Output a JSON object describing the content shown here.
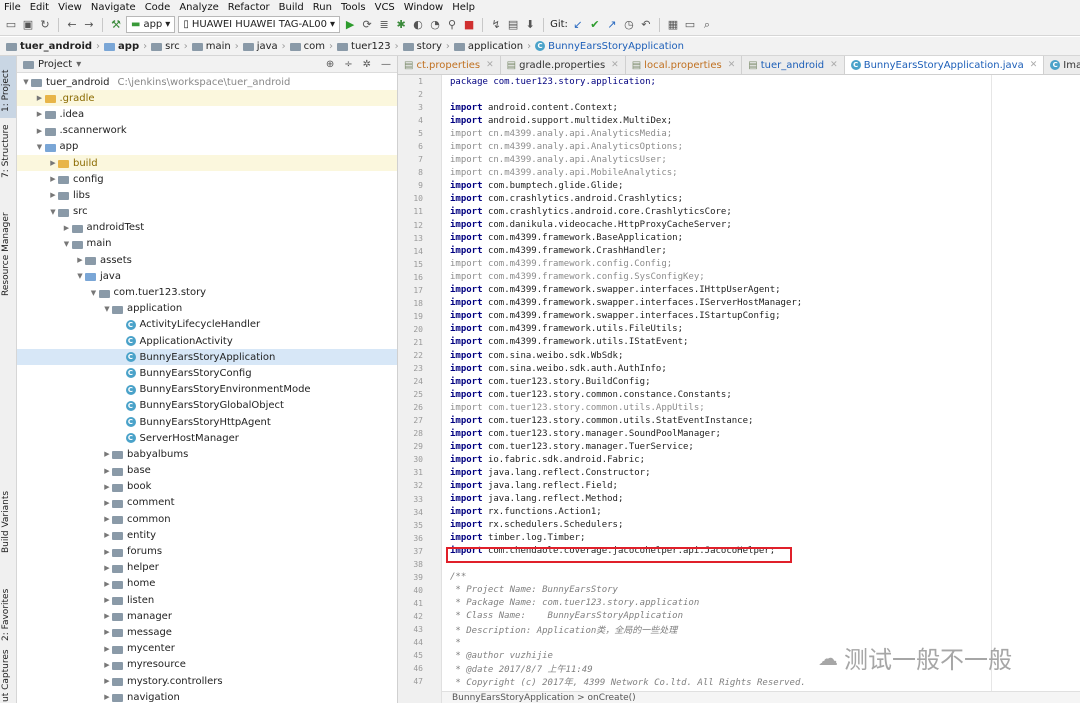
{
  "menu": [
    "File",
    "Edit",
    "View",
    "Navigate",
    "Code",
    "Analyze",
    "Refactor",
    "Build",
    "Run",
    "Tools",
    "VCS",
    "Window",
    "Help"
  ],
  "toolbar": {
    "config": "app",
    "device": "HUAWEI HUAWEI TAG-AL00",
    "git_label": "Git:"
  },
  "breadcrumb": [
    "tuer_android",
    "app",
    "src",
    "main",
    "java",
    "com",
    "tuer123",
    "story",
    "application",
    "BunnyEarsStoryApplication"
  ],
  "side_tabs": {
    "project": "1: Project",
    "structure": "7: Structure",
    "resource": "Resource Manager",
    "variants": "Build Variants",
    "favorites": "2: Favorites",
    "captures": "ut Captures"
  },
  "project_panel": {
    "title": "Project"
  },
  "tree": [
    {
      "label": "tuer_android",
      "extra": "C:\\jenkins\\workspace\\tuer_android",
      "indent": 0,
      "arrow": "▼",
      "icon": "fold"
    },
    {
      "label": ".gradle",
      "indent": 1,
      "arrow": "▶",
      "icon": "fold o",
      "hl": true
    },
    {
      "label": ".idea",
      "indent": 1,
      "arrow": "▶",
      "icon": "fold"
    },
    {
      "label": ".scannerwork",
      "indent": 1,
      "arrow": "▶",
      "icon": "fold"
    },
    {
      "label": "app",
      "indent": 1,
      "arrow": "▼",
      "icon": "fold b"
    },
    {
      "label": "build",
      "indent": 2,
      "arrow": "▶",
      "icon": "fold o",
      "hl": true
    },
    {
      "label": "config",
      "indent": 2,
      "arrow": "▶",
      "icon": "fold"
    },
    {
      "label": "libs",
      "indent": 2,
      "arrow": "▶",
      "icon": "fold"
    },
    {
      "label": "src",
      "indent": 2,
      "arrow": "▼",
      "icon": "fold"
    },
    {
      "label": "androidTest",
      "indent": 3,
      "arrow": "▶",
      "icon": "fold"
    },
    {
      "label": "main",
      "indent": 3,
      "arrow": "▼",
      "icon": "fold"
    },
    {
      "label": "assets",
      "indent": 4,
      "arrow": "▶",
      "icon": "fold"
    },
    {
      "label": "java",
      "indent": 4,
      "arrow": "▼",
      "icon": "fold b"
    },
    {
      "label": "com.tuer123.story",
      "indent": 5,
      "arrow": "▼",
      "icon": "fold"
    },
    {
      "label": "application",
      "indent": 6,
      "arrow": "▼",
      "icon": "fold"
    },
    {
      "label": "ActivityLifecycleHandler",
      "indent": 7,
      "arrow": "",
      "icon": "cls"
    },
    {
      "label": "ApplicationActivity",
      "indent": 7,
      "arrow": "",
      "icon": "cls"
    },
    {
      "label": "BunnyEarsStoryApplication",
      "indent": 7,
      "arrow": "",
      "icon": "cls",
      "sel": true
    },
    {
      "label": "BunnyEarsStoryConfig",
      "indent": 7,
      "arrow": "",
      "icon": "cls"
    },
    {
      "label": "BunnyEarsStoryEnvironmentMode",
      "indent": 7,
      "arrow": "",
      "icon": "cls"
    },
    {
      "label": "BunnyEarsStoryGlobalObject",
      "indent": 7,
      "arrow": "",
      "icon": "cls"
    },
    {
      "label": "BunnyEarsStoryHttpAgent",
      "indent": 7,
      "arrow": "",
      "icon": "cls"
    },
    {
      "label": "ServerHostManager",
      "indent": 7,
      "arrow": "",
      "icon": "cls"
    },
    {
      "label": "babyalbums",
      "indent": 6,
      "arrow": "▶",
      "icon": "fold"
    },
    {
      "label": "base",
      "indent": 6,
      "arrow": "▶",
      "icon": "fold"
    },
    {
      "label": "book",
      "indent": 6,
      "arrow": "▶",
      "icon": "fold"
    },
    {
      "label": "comment",
      "indent": 6,
      "arrow": "▶",
      "icon": "fold"
    },
    {
      "label": "common",
      "indent": 6,
      "arrow": "▶",
      "icon": "fold"
    },
    {
      "label": "entity",
      "indent": 6,
      "arrow": "▶",
      "icon": "fold"
    },
    {
      "label": "forums",
      "indent": 6,
      "arrow": "▶",
      "icon": "fold"
    },
    {
      "label": "helper",
      "indent": 6,
      "arrow": "▶",
      "icon": "fold"
    },
    {
      "label": "home",
      "indent": 6,
      "arrow": "▶",
      "icon": "fold"
    },
    {
      "label": "listen",
      "indent": 6,
      "arrow": "▶",
      "icon": "fold"
    },
    {
      "label": "manager",
      "indent": 6,
      "arrow": "▶",
      "icon": "fold"
    },
    {
      "label": "message",
      "indent": 6,
      "arrow": "▶",
      "icon": "fold"
    },
    {
      "label": "mycenter",
      "indent": 6,
      "arrow": "▶",
      "icon": "fold"
    },
    {
      "label": "myresource",
      "indent": 6,
      "arrow": "▶",
      "icon": "fold"
    },
    {
      "label": "mystory.controllers",
      "indent": 6,
      "arrow": "▶",
      "icon": "fold"
    },
    {
      "label": "navigation",
      "indent": 6,
      "arrow": "▶",
      "icon": "fold"
    }
  ],
  "tabs": [
    {
      "label": "ct.properties",
      "active": false
    },
    {
      "label": "gradle.properties",
      "active": false
    },
    {
      "label": "local.properties",
      "active": false
    },
    {
      "label": "tuer_android",
      "active": false
    },
    {
      "label": "BunnyEarsStoryApplication.java",
      "active": true
    },
    {
      "label": "ImageCompressor.ja",
      "active": false
    }
  ],
  "code": [
    {
      "n": "1",
      "t": "package com.tuer123.story.application;",
      "k": "package"
    },
    {
      "n": "2",
      "t": ""
    },
    {
      "n": "3",
      "t": "android.content.Context;",
      "k": "import"
    },
    {
      "n": "4",
      "t": "android.support.multidex.MultiDex;",
      "k": "import"
    },
    {
      "n": "5",
      "t": "cn.m4399.analy.api.AnalyticsMedia;",
      "k": "import",
      "dim": true
    },
    {
      "n": "6",
      "t": "cn.m4399.analy.api.AnalyticsOptions;",
      "k": "import",
      "dim": true
    },
    {
      "n": "7",
      "t": "cn.m4399.analy.api.AnalyticsUser;",
      "k": "import",
      "dim": true
    },
    {
      "n": "8",
      "t": "cn.m4399.analy.api.MobileAnalytics;",
      "k": "import",
      "dim": true
    },
    {
      "n": "9",
      "t": "com.bumptech.glide.Glide;",
      "k": "import"
    },
    {
      "n": "10",
      "t": "com.crashlytics.android.Crashlytics;",
      "k": "import"
    },
    {
      "n": "11",
      "t": "com.crashlytics.android.core.CrashlyticsCore;",
      "k": "import"
    },
    {
      "n": "12",
      "t": "com.danikula.videocache.HttpProxyCacheServer;",
      "k": "import"
    },
    {
      "n": "13",
      "t": "com.m4399.framework.BaseApplication;",
      "k": "import"
    },
    {
      "n": "14",
      "t": "com.m4399.framework.CrashHandler;",
      "k": "import"
    },
    {
      "n": "15",
      "t": "com.m4399.framework.config.Config;",
      "k": "import",
      "dim": true
    },
    {
      "n": "16",
      "t": "com.m4399.framework.config.SysConfigKey;",
      "k": "import",
      "dim": true
    },
    {
      "n": "17",
      "t": "com.m4399.framework.swapper.interfaces.IHttpUserAgent;",
      "k": "import"
    },
    {
      "n": "18",
      "t": "com.m4399.framework.swapper.interfaces.IServerHostManager;",
      "k": "import"
    },
    {
      "n": "19",
      "t": "com.m4399.framework.swapper.interfaces.IStartupConfig;",
      "k": "import"
    },
    {
      "n": "20",
      "t": "com.m4399.framework.utils.FileUtils;",
      "k": "import"
    },
    {
      "n": "21",
      "t": "com.m4399.framework.utils.IStatEvent;",
      "k": "import"
    },
    {
      "n": "22",
      "t": "com.sina.weibo.sdk.WbSdk;",
      "k": "import"
    },
    {
      "n": "23",
      "t": "com.sina.weibo.sdk.auth.AuthInfo;",
      "k": "import"
    },
    {
      "n": "24",
      "t": "com.tuer123.story.BuildConfig;",
      "k": "import"
    },
    {
      "n": "25",
      "t": "com.tuer123.story.common.constance.Constants;",
      "k": "import"
    },
    {
      "n": "26",
      "t": "com.tuer123.story.common.utils.AppUtils;",
      "k": "import",
      "dim": true
    },
    {
      "n": "27",
      "t": "com.tuer123.story.common.utils.StatEventInstance;",
      "k": "import"
    },
    {
      "n": "28",
      "t": "com.tuer123.story.manager.SoundPoolManager;",
      "k": "import"
    },
    {
      "n": "29",
      "t": "com.tuer123.story.manager.TuerService;",
      "k": "import"
    },
    {
      "n": "30",
      "t": "io.fabric.sdk.android.Fabric;",
      "k": "import"
    },
    {
      "n": "31",
      "t": "java.lang.reflect.Constructor;",
      "k": "import"
    },
    {
      "n": "32",
      "t": "java.lang.reflect.Field;",
      "k": "import"
    },
    {
      "n": "33",
      "t": "java.lang.reflect.Method;",
      "k": "import"
    },
    {
      "n": "34",
      "t": "rx.functions.Action1;",
      "k": "import"
    },
    {
      "n": "35",
      "t": "rx.schedulers.Schedulers;",
      "k": "import"
    },
    {
      "n": "36",
      "t": "timber.log.Timber;",
      "k": "import"
    },
    {
      "n": "37",
      "t": "com.chendaole.coverage.jacocohelper.api.JacocoHelper;",
      "k": "import"
    },
    {
      "n": "38",
      "t": ""
    },
    {
      "n": "39",
      "t": "/**",
      "cm": true
    },
    {
      "n": "40",
      "t": " * Project Name: BunnyEarsStory",
      "cm": true
    },
    {
      "n": "41",
      "t": " * Package Name: com.tuer123.story.application",
      "cm": true
    },
    {
      "n": "42",
      "t": " * Class Name:    BunnyEarsStoryApplication",
      "cm": true
    },
    {
      "n": "43",
      "t": " * Description: Application类，全局的一些处理",
      "cm": true
    },
    {
      "n": "44",
      "t": " *",
      "cm": true
    },
    {
      "n": "45",
      "t": " * @author vuzhijie",
      "cm": true
    },
    {
      "n": "46",
      "t": " * @date 2017/8/7 上午11:49",
      "cm": true
    },
    {
      "n": "47",
      "t": " * Copyright (c) 2017年, 4399 Network Co.ltd. All Rights Reserved.",
      "cm": true
    }
  ],
  "status": "BunnyEarsStoryApplication  >  onCreate()",
  "watermark": "测试一般不一般"
}
